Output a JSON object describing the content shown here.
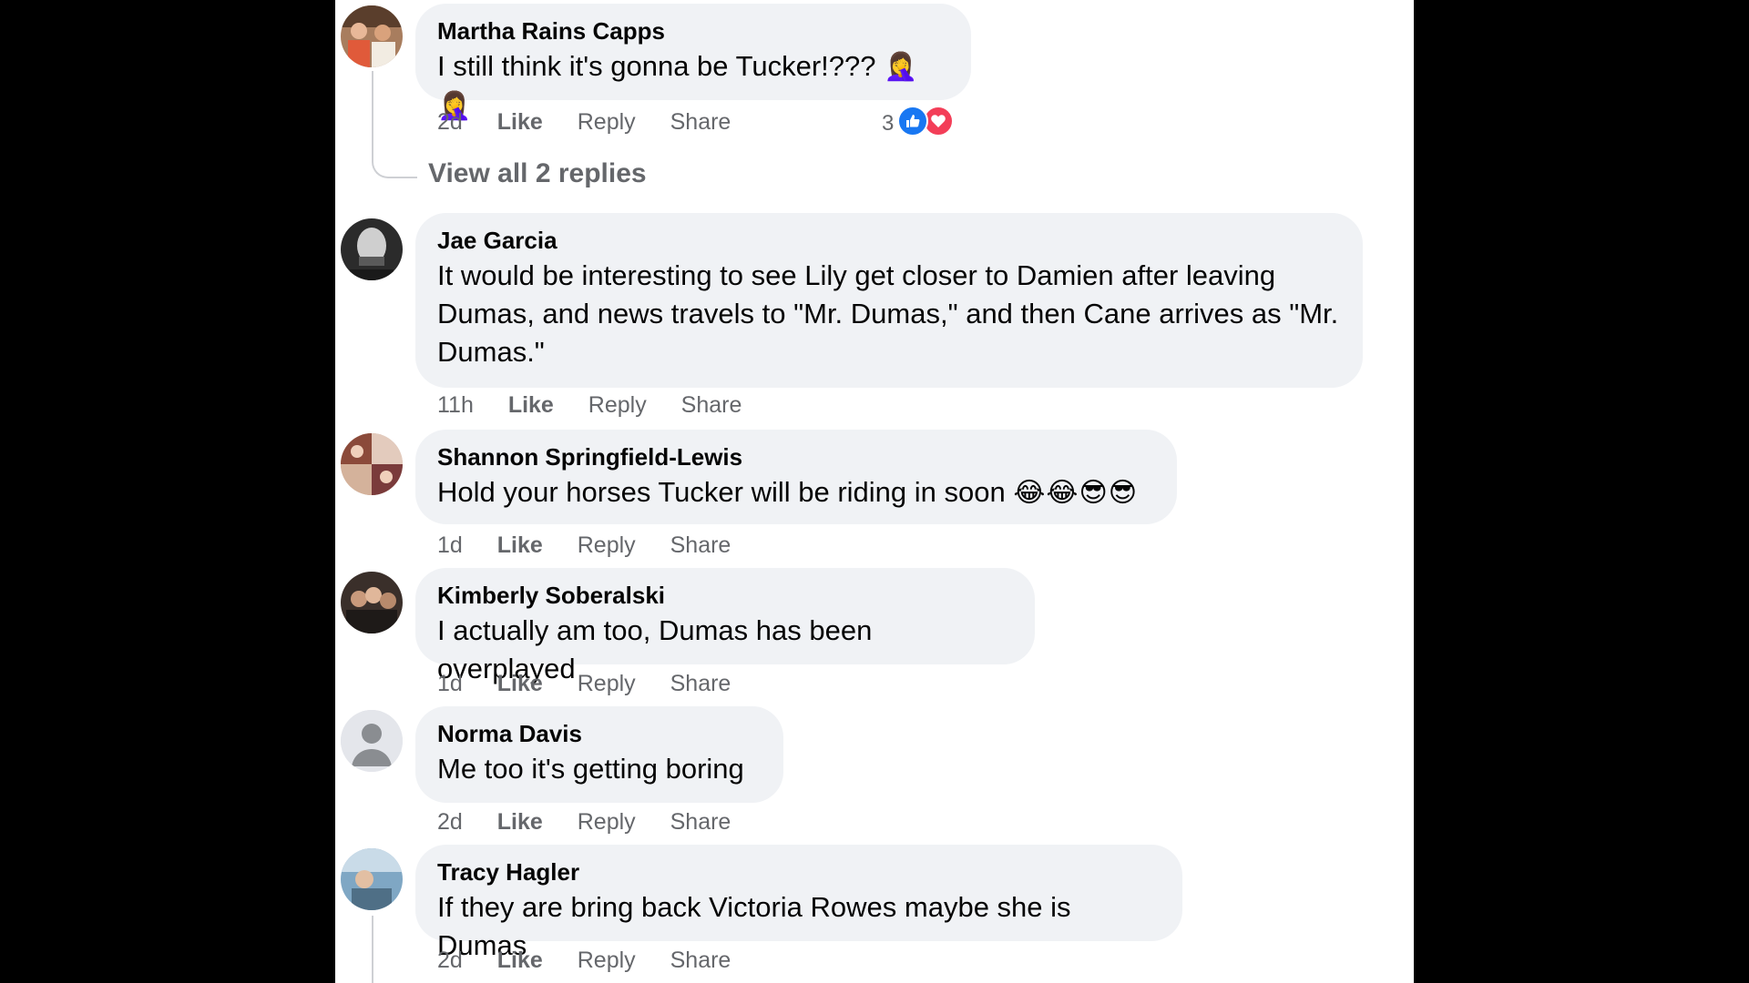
{
  "comments": [
    {
      "author": "Martha Rains Capps",
      "text": "I still think it's gonna be Tucker!???",
      "emoji": "🤦‍♀️🤦‍♀️",
      "time": "2d",
      "like": "Like",
      "reply": "Reply",
      "share": "Share",
      "reaction_count": "3",
      "view_replies": "View all 2 replies"
    },
    {
      "author": "Jae Garcia",
      "text": "It would be interesting to see Lily get closer to Damien after leaving Dumas, and news travels to \"Mr. Dumas,\" and then Cane arrives as \"Mr. Dumas.\"",
      "time": "11h",
      "like": "Like",
      "reply": "Reply",
      "share": "Share"
    },
    {
      "author": "Shannon Springfield-Lewis",
      "text": "Hold your horses Tucker will be riding in soon",
      "emoji": "😂😂😎😎",
      "time": "1d",
      "like": "Like",
      "reply": "Reply",
      "share": "Share"
    },
    {
      "author": "Kimberly Soberalski",
      "text": "I actually am too, Dumas has been overplayed",
      "time": "1d",
      "like": "Like",
      "reply": "Reply",
      "share": "Share"
    },
    {
      "author": "Norma Davis",
      "text": "Me too it's getting boring",
      "time": "2d",
      "like": "Like",
      "reply": "Reply",
      "share": "Share"
    },
    {
      "author": "Tracy Hagler",
      "text": "If they are bring back Victoria Rowes maybe she is Dumas",
      "time": "2d",
      "like": "Like",
      "reply": "Reply",
      "share": "Share"
    }
  ],
  "colors": {
    "like_blue": "#1877f2",
    "love_red": "#f33e58",
    "bubble": "#f0f2f5",
    "secondary_text": "#65676b"
  }
}
